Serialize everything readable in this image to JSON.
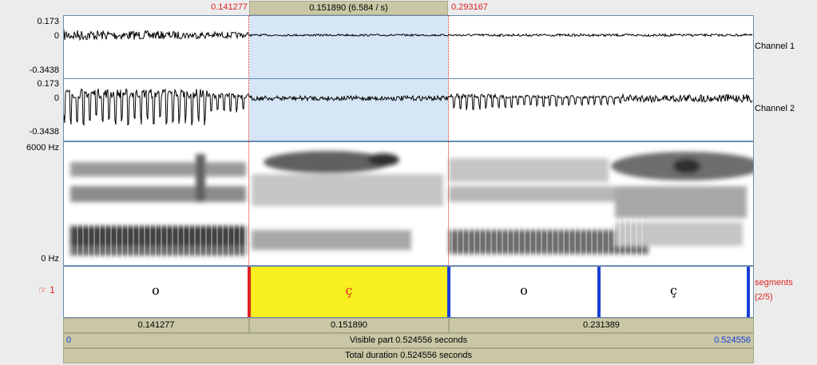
{
  "selection": {
    "start": "0.141277",
    "duration_label": "0.151890 (6.584 / s)",
    "end": "0.293167"
  },
  "waveform": {
    "channel1": {
      "label": "Channel 1",
      "ymax": "0.173",
      "zero": "0",
      "ymin": "-0.3438"
    },
    "channel2": {
      "label": "Channel 2",
      "ymax": "0.173",
      "zero": "0",
      "ymin": "-0.3438"
    }
  },
  "spectrogram": {
    "fmax": "6000 Hz",
    "fmin": "0 Hz"
  },
  "tier": {
    "pointer": "☞ 1",
    "name": "segments",
    "count": "(2/5)",
    "intervals": [
      "o",
      "ç",
      "o",
      "ç"
    ]
  },
  "durations": {
    "left": "0.141277",
    "selected": "0.151890",
    "right": "0.231389"
  },
  "visible": {
    "start": "0",
    "label": "Visible part 0.524556 seconds",
    "end": "0.524556"
  },
  "total": {
    "label": "Total duration 0.524556 seconds"
  },
  "colors": {
    "selection": "#d6e6f7",
    "interval_highlight": "#f7ef1e",
    "boundary": "#1a3ed8",
    "cursor": "#d22"
  }
}
